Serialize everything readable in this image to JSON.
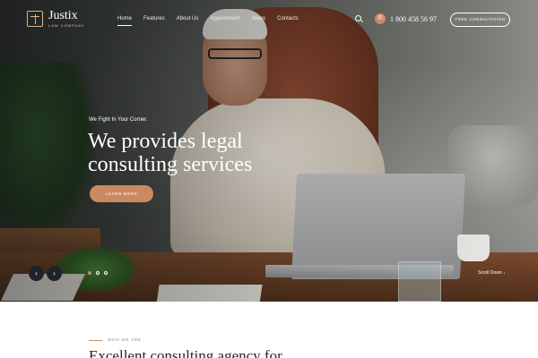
{
  "brand": {
    "name": "Justix",
    "tagline": "LAW COMPANY",
    "accent_color": "#c98a62",
    "dark_color": "#1f2329"
  },
  "nav": {
    "items": [
      {
        "label": "Home",
        "active": true
      },
      {
        "label": "Features"
      },
      {
        "label": "About Us"
      },
      {
        "label": "Appointment"
      },
      {
        "label": "News"
      },
      {
        "label": "Contacts"
      }
    ],
    "search_icon": "search-icon",
    "phone_icon": "phone-icon",
    "phone_number": "1 800 458 56 97",
    "cta_label": "FREE CONSULTATION"
  },
  "hero": {
    "tagline": "We Fight In Your Corner.",
    "title": "We provides legal consulting services",
    "button_label": "LEARN MORE",
    "prev_icon": "arrow-left-icon",
    "next_icon": "arrow-right-icon",
    "prev_glyph": "‹",
    "next_glyph": "›",
    "slides_total": 3,
    "active_slide": 1,
    "scroll_label": "Scroll Down  ↓"
  },
  "about": {
    "label": "WHO WE ARE",
    "heading": "Excellent consulting agency for"
  }
}
